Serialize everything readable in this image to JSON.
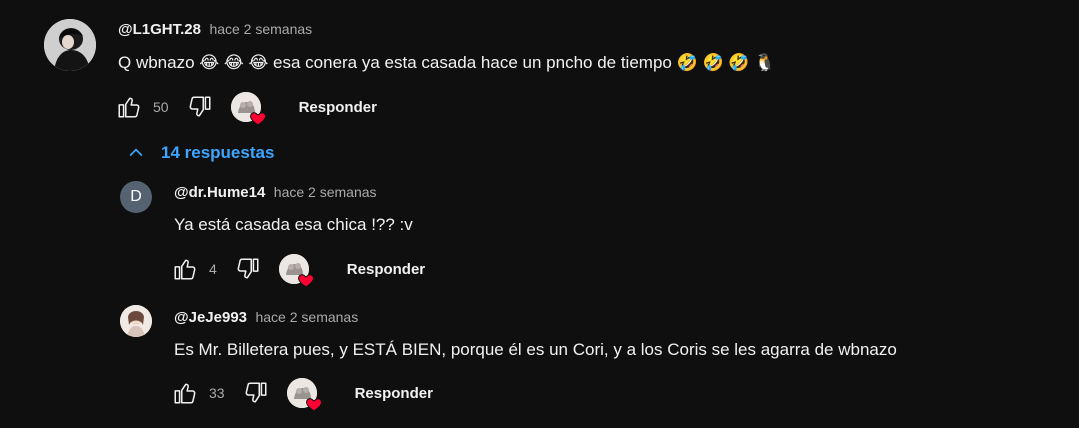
{
  "comment": {
    "author": "@L1GHT.28",
    "time": "hace 2 semanas",
    "text": "Q wbnazo 😂 😂 😂  esa conera ya esta casada hace un pncho de tiempo 🤣 🤣 🤣 🐧",
    "likes": "50",
    "reply_label": "Responder"
  },
  "replies_toggle": {
    "label": "14 respuestas"
  },
  "replies": [
    {
      "author": "@dr.Hume14",
      "time": "hace 2 semanas",
      "text": "Ya está casada esa chica !?? :v",
      "likes": "4",
      "reply_label": "Responder",
      "avatar_letter": "D"
    },
    {
      "author": "@JeJe993",
      "time": "hace 2 semanas",
      "text": "Es Mr. Billetera pues, y ESTÁ BIEN, porque él es un Cori, y a los Coris se les agarra de wbnazo",
      "likes": "33",
      "reply_label": "Responder"
    }
  ],
  "colors": {
    "background": "#0f0f0f",
    "link": "#3ea6ff",
    "heart": "#ff0033",
    "muted_text": "#aaaaaa"
  }
}
